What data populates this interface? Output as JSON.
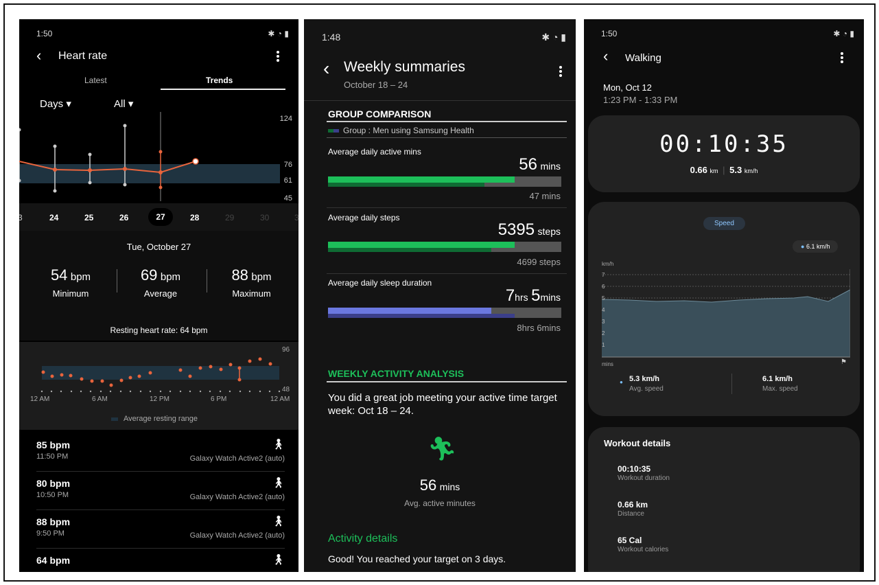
{
  "p1": {
    "status_time": "1:50",
    "title": "Heart rate",
    "tabs": [
      "Latest",
      "Trends"
    ],
    "filter_period": "Days",
    "filter_type": "All",
    "y_ticks": [
      "124",
      "76",
      "61",
      "45"
    ],
    "dates": [
      "3",
      "24",
      "25",
      "26",
      "27",
      "28",
      "29",
      "30",
      "3"
    ],
    "selected_date": "Tue, October 27",
    "min_value": "54",
    "avg_value": "69",
    "max_value": "88",
    "unit": "bpm",
    "min_label": "Minimum",
    "avg_label": "Average",
    "max_label": "Maximum",
    "resting": "Resting heart rate: 64 bpm",
    "rest_y_ticks": [
      "96",
      "48"
    ],
    "rest_x_ticks": [
      "12 AM",
      "6 AM",
      "12 PM",
      "6 PM",
      "12 AM"
    ],
    "legend": "Average resting range",
    "readings": [
      {
        "value": "85 bpm",
        "time": "11:50 PM",
        "device": "Galaxy Watch Active2 (auto)"
      },
      {
        "value": "80 bpm",
        "time": "10:50 PM",
        "device": "Galaxy Watch Active2 (auto)"
      },
      {
        "value": "88 bpm",
        "time": "9:50 PM",
        "device": "Galaxy Watch Active2 (auto)"
      },
      {
        "value": "64 bpm",
        "time": "",
        "device": ""
      }
    ],
    "colors": {
      "accent": "#e8643c",
      "band": "#1f3340"
    }
  },
  "p2": {
    "status_time": "1:48",
    "title": "Weekly summaries",
    "subtitle": "October 18 – 24",
    "section1": "GROUP COMPARISON",
    "group_legend": "Group : Men using Samsung Health",
    "metrics": [
      {
        "label": "Average daily active mins",
        "value": "56",
        "unit": "mins",
        "group": "47 mins",
        "mine_frac": 0.8,
        "group_frac": 0.67
      },
      {
        "label": "Average daily steps",
        "value": "5395",
        "unit": "steps",
        "group": "4699 steps",
        "mine_frac": 0.8,
        "group_frac": 0.7
      },
      {
        "label": "Average daily sleep duration",
        "value_a": "7",
        "unit_a": "hrs",
        "value_b": "5",
        "unit_b": "mins",
        "group": "8hrs 6mins",
        "mine_frac": 0.7,
        "group_frac": 0.8
      }
    ],
    "section2": "WEEKLY ACTIVITY ANALYSIS",
    "analysis": "You did a great job meeting your active time target week: Oct 18 – 24.",
    "avg_value": "56",
    "avg_unit": "mins",
    "avg_label": "Avg. active minutes",
    "details_title": "Activity details",
    "details_text": "Good! You reached your target on 3 days.",
    "colors": {
      "green": "#1dbf5a",
      "dark_green": "#0f6b34",
      "blue": "#6b78e0",
      "dark_blue": "#3b3f8a"
    }
  },
  "p3": {
    "status_time": "1:50",
    "title": "Walking",
    "date": "Mon, Oct 12",
    "time_range": "1:23 PM - 1:33 PM",
    "duration": "00:10:35",
    "distance_v": "0.66",
    "distance_u": "km",
    "speed_v": "5.3",
    "speed_u": "km/h",
    "chip": "Speed",
    "tooltip": "6.1 km/h",
    "y_unit": "km/h",
    "y_ticks": [
      "7",
      "6",
      "5",
      "4",
      "3",
      "2",
      "1"
    ],
    "x_unit": "mins",
    "avg_speed": "5.3 km/h",
    "avg_speed_label": "Avg. speed",
    "max_speed": "6.1 km/h",
    "max_speed_label": "Max. speed",
    "details_title": "Workout details",
    "details": [
      {
        "value": "00:10:35",
        "label": "Workout duration"
      },
      {
        "value": "0.66 km",
        "label": "Distance"
      },
      {
        "value": "65 Cal",
        "label": "Workout calories"
      }
    ]
  }
}
